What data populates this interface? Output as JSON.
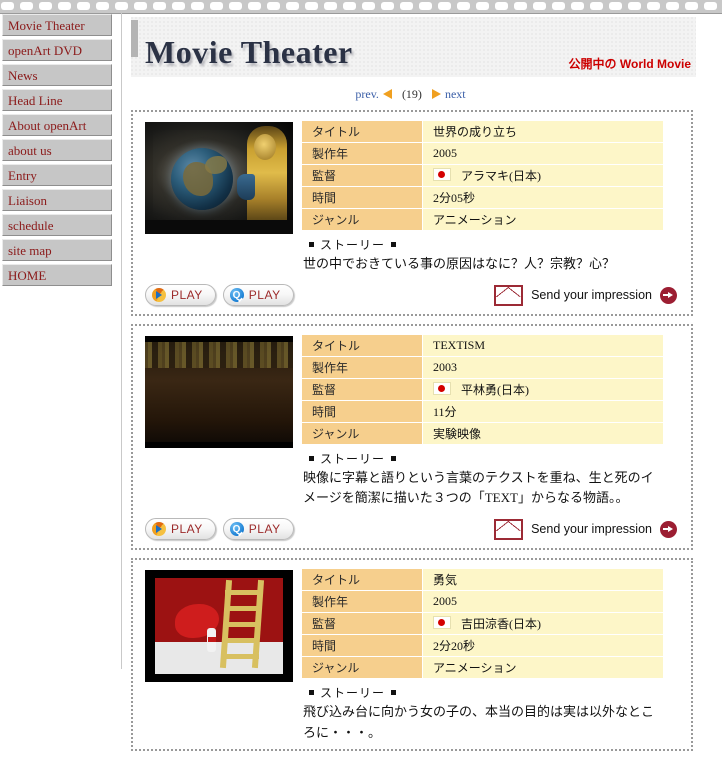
{
  "sidebar": {
    "items": [
      {
        "label": "Movie Theater"
      },
      {
        "label": "openArt DVD"
      },
      {
        "label": "News"
      },
      {
        "label": "Head Line"
      },
      {
        "label": "About openArt"
      },
      {
        "label": "about us"
      },
      {
        "label": "Entry"
      },
      {
        "label": "Liaison"
      },
      {
        "label": "schedule"
      },
      {
        "label": "site map"
      },
      {
        "label": "HOME"
      }
    ]
  },
  "masthead": {
    "title": "Movie Theater",
    "subtitle": "公開中の World Movie"
  },
  "pager": {
    "prev_label": "prev.",
    "count_label": "(19)",
    "next_label": "next"
  },
  "labels": {
    "title": "タイトル",
    "year": "製作年",
    "director": "監督",
    "duration": "時間",
    "genre": "ジャンル",
    "story": "ストーリー",
    "play": "PLAY",
    "impression": "Send your impression"
  },
  "movies": [
    {
      "thumb_alt": "globe-and-golden-figure",
      "title": "世界の成り立ち",
      "year": "2005",
      "director": "アラマキ(日本)",
      "duration": "2分05秒",
      "genre": "アニメーション",
      "story": "世の中でおきている事の原因はなに？人？宗教？心？"
    },
    {
      "thumb_alt": "dark-forest-with-subtitles",
      "title": "TEXTISM",
      "year": "2003",
      "director": "平林勇(日本)",
      "duration": "11分",
      "genre": "実験映像",
      "story": "映像に字幕と語りという言葉のテクストを重ね、生と死のイメージを簡潔に描いた３つの「TEXT」からなる物語。。"
    },
    {
      "thumb_alt": "red-wall-with-ladder",
      "title": "勇気",
      "year": "2005",
      "director": "吉田涼香(日本)",
      "duration": "2分20秒",
      "genre": "アニメーション",
      "story": "飛び込み台に向かう女の子の、本当の目的は実は以外なところに・・・。"
    }
  ]
}
